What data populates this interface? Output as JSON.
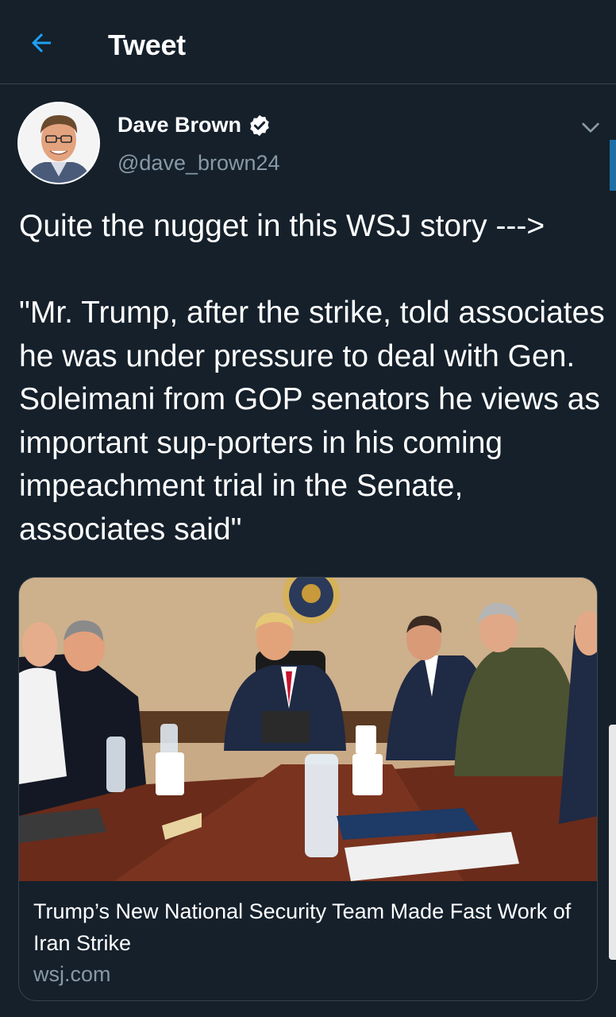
{
  "header": {
    "title": "Tweet",
    "back_icon": "arrow-left-icon",
    "accent_color": "#1da1f2"
  },
  "tweet": {
    "author_name": "Dave Brown",
    "verified": true,
    "handle": "@dave_brown24",
    "text": "Quite the nugget in this WSJ story --->\n\n\"Mr. Trump, after the strike, told associates he was under pressure to deal with Gen. Soleimani from GOP senators he views as important sup-porters in his coming impeachment trial in the Senate, associates said\""
  },
  "link_card": {
    "title": "Trump’s New National Security Team Made Fast Work of Iran Strike",
    "domain": "wsj.com"
  },
  "colors": {
    "background": "#15202b",
    "secondary_text": "#8899a6",
    "border": "#38444d"
  }
}
